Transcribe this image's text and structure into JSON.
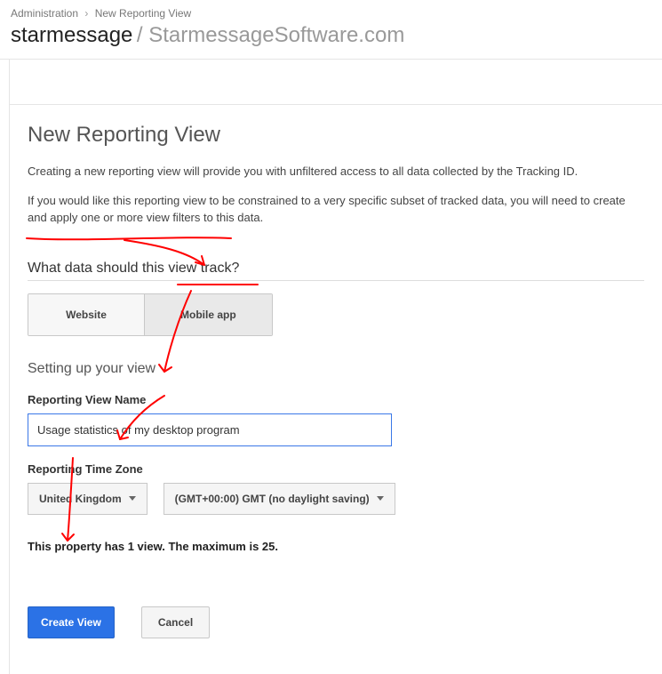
{
  "breadcrumb": {
    "root": "Administration",
    "current": "New Reporting View"
  },
  "header": {
    "account": "starmessage",
    "property": "StarmessageSoftware.com"
  },
  "page": {
    "title": "New Reporting View",
    "desc1": "Creating a new reporting view will provide you with unfiltered access to all data collected by the Tracking ID.",
    "desc2": "If you would like this reporting view to be constrained to a very specific subset of tracked data, you will need to create and apply one or more view filters to this data."
  },
  "track_section": {
    "heading": "What data should this view track?",
    "options": [
      "Website",
      "Mobile app"
    ],
    "selected_index": 1
  },
  "setup_section": {
    "heading": "Setting up your view",
    "name_label": "Reporting View Name",
    "name_value": "Usage statistics of my desktop program",
    "tz_label": "Reporting Time Zone",
    "tz_country": "United Kingdom",
    "tz_offset": "(GMT+00:00) GMT (no daylight saving)"
  },
  "limit_note": "This property has 1 view. The maximum is 25.",
  "actions": {
    "create": "Create View",
    "cancel": "Cancel"
  }
}
